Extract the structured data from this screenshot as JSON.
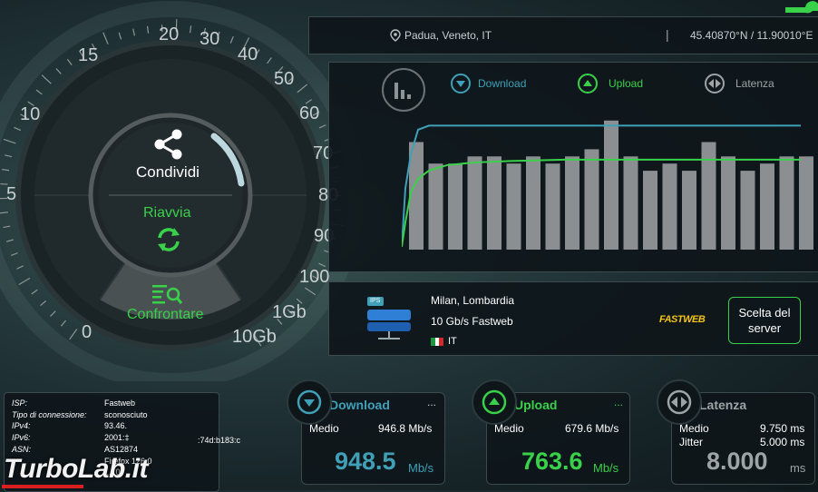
{
  "header": {
    "location": "Padua, Veneto, IT",
    "separator": "|",
    "coords": "45.40870°N / 11.90010°E"
  },
  "gauge": {
    "scale": [
      "0",
      "5",
      "10",
      "15",
      "20",
      "30",
      "40",
      "50",
      "60",
      "70",
      "80",
      "90",
      "100",
      "1Gb",
      "10Gb"
    ],
    "share_label": "Condividi",
    "restart_label": "Riavvia",
    "compare_label": "Confrontare"
  },
  "chart": {
    "legend_download": "Download",
    "legend_upload": "Upload",
    "legend_latency": "Latenza",
    "colors": {
      "download": "#3fa0b8",
      "upload": "#39d14a",
      "latency": "#9ea4a6",
      "bars": "#8c8f91"
    }
  },
  "chart_data": {
    "type": "bar",
    "bar_values": [
      0.75,
      0.6,
      0.6,
      0.65,
      0.65,
      0.6,
      0.65,
      0.6,
      0.65,
      0.7,
      0.9,
      0.65,
      0.55,
      0.6,
      0.55,
      0.75,
      0.65,
      0.55,
      0.6,
      0.65,
      0.65
    ],
    "download_line": [
      0.02,
      0.45,
      0.7,
      0.88,
      0.91,
      0.91,
      0.91,
      0.91,
      0.91,
      0.91,
      0.91,
      0.91
    ],
    "upload_line": [
      0.02,
      0.2,
      0.42,
      0.52,
      0.58,
      0.62,
      0.64,
      0.65,
      0.66,
      0.66,
      0.66,
      0.66
    ]
  },
  "server": {
    "icon_tag": "IPS",
    "city": "Milan, Lombardia",
    "provider": "10 Gb/s Fastweb",
    "country": "IT",
    "logo": "FASTWEB",
    "select_label": "Scelta del server"
  },
  "info": {
    "rows": [
      {
        "label": "ISP:",
        "value": "Fastweb"
      },
      {
        "label": "Tipo di connessione:",
        "value": "sconosciuto"
      },
      {
        "label": "IPv4:",
        "value": "93.46."
      },
      {
        "label": "IPv6:",
        "value": "2001:‡",
        "value2": ":74d:b183:c"
      },
      {
        "label": "ASN:",
        "value": "AS12874"
      },
      {
        "label": "",
        "value": "Firefox 126.0"
      },
      {
        "label": "",
        "value": "...10"
      }
    ]
  },
  "download": {
    "title": "Download",
    "more": "...",
    "avg_label": "Medio",
    "avg_value": "946.8 Mb/s",
    "big_value": "948.5",
    "unit": "Mb/s"
  },
  "upload": {
    "title": "Upload",
    "more": "...",
    "avg_label": "Medio",
    "avg_value": "679.6 Mb/s",
    "big_value": "763.6",
    "unit": "Mb/s"
  },
  "latency": {
    "title": "Latenza",
    "avg_label": "Medio",
    "avg_value": "9.750 ms",
    "jitter_label": "Jitter",
    "jitter_value": "5.000 ms",
    "big_value": "8.000",
    "unit": "ms"
  },
  "watermark": "TurboLab.it"
}
